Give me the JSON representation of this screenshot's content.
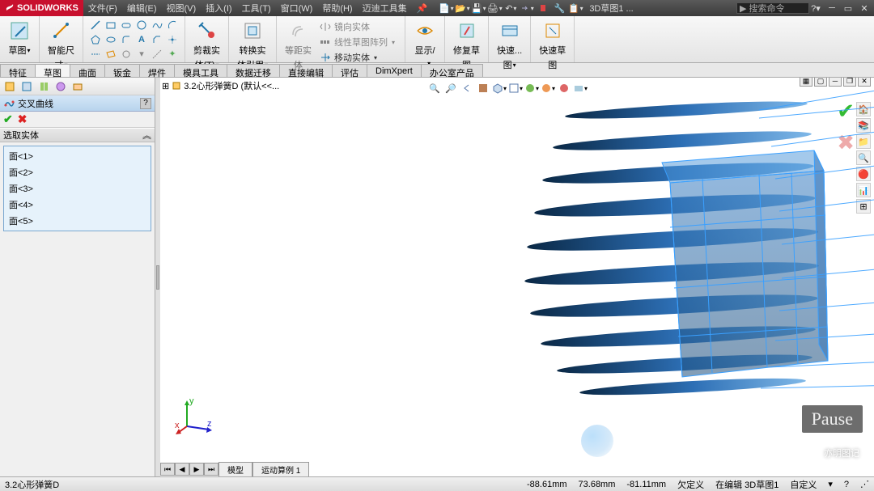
{
  "app": {
    "brand": "SOLIDWORKS"
  },
  "menu": [
    "文件(F)",
    "编辑(E)",
    "视图(V)",
    "插入(I)",
    "工具(T)",
    "窗口(W)",
    "帮助(H)",
    "迈迪工具集"
  ],
  "title_doc": "3D草图1 ...",
  "search_placeholder": "搜索命令",
  "ribbon": {
    "sketch": {
      "label": "草图",
      "dd": "▾"
    },
    "smart_dim": {
      "label": "智能尺",
      "sub": "寸",
      "dd": "▾"
    },
    "trim": {
      "label": "剪裁实",
      "sub": "体(T)",
      "dd": "▾"
    },
    "convert": {
      "label": "转换实",
      "sub": "体引用",
      "dd": "▾"
    },
    "offset": {
      "label": "等距实",
      "sub": "体"
    },
    "mirror": "镜向实体",
    "linear_pattern": "线性草图阵列",
    "move": "移动实体",
    "display": {
      "label": "显示/",
      "sub": "...",
      "dd": "▾"
    },
    "repair": {
      "label": "修复草",
      "sub": "图"
    },
    "rapid": {
      "label": "快速...",
      "sub": "图",
      "dd": "▾"
    },
    "rapid2": {
      "label": "快速草",
      "sub": "图"
    }
  },
  "tabs": [
    "特征",
    "草图",
    "曲面",
    "钣金",
    "焊件",
    "模具工具",
    "数据迁移",
    "直接编辑",
    "评估",
    "DimXpert",
    "办公室产品"
  ],
  "tabs_active_index": 1,
  "left": {
    "feature_title": "交叉曲线",
    "section": "选取实体",
    "items": [
      "面<1>",
      "面<2>",
      "面<3>",
      "面<4>",
      "面<5>"
    ]
  },
  "tree_root": "3.2心形弹簧D  (默认<<...",
  "bottom_tabs": [
    "模型",
    "运动算例 1"
  ],
  "status": {
    "doc": "3.2心形弹簧D",
    "coord1": "-88.61mm",
    "coord2": "73.68mm",
    "coord3": "-81.11mm",
    "state1": "欠定义",
    "state2": "在编辑 3D草图1",
    "state3": "自定义"
  },
  "overlay": {
    "pause": "Pause",
    "watermark": "亦明图记"
  },
  "colors": {
    "accent": "#2d6fb5",
    "brand": "#c8102e"
  }
}
